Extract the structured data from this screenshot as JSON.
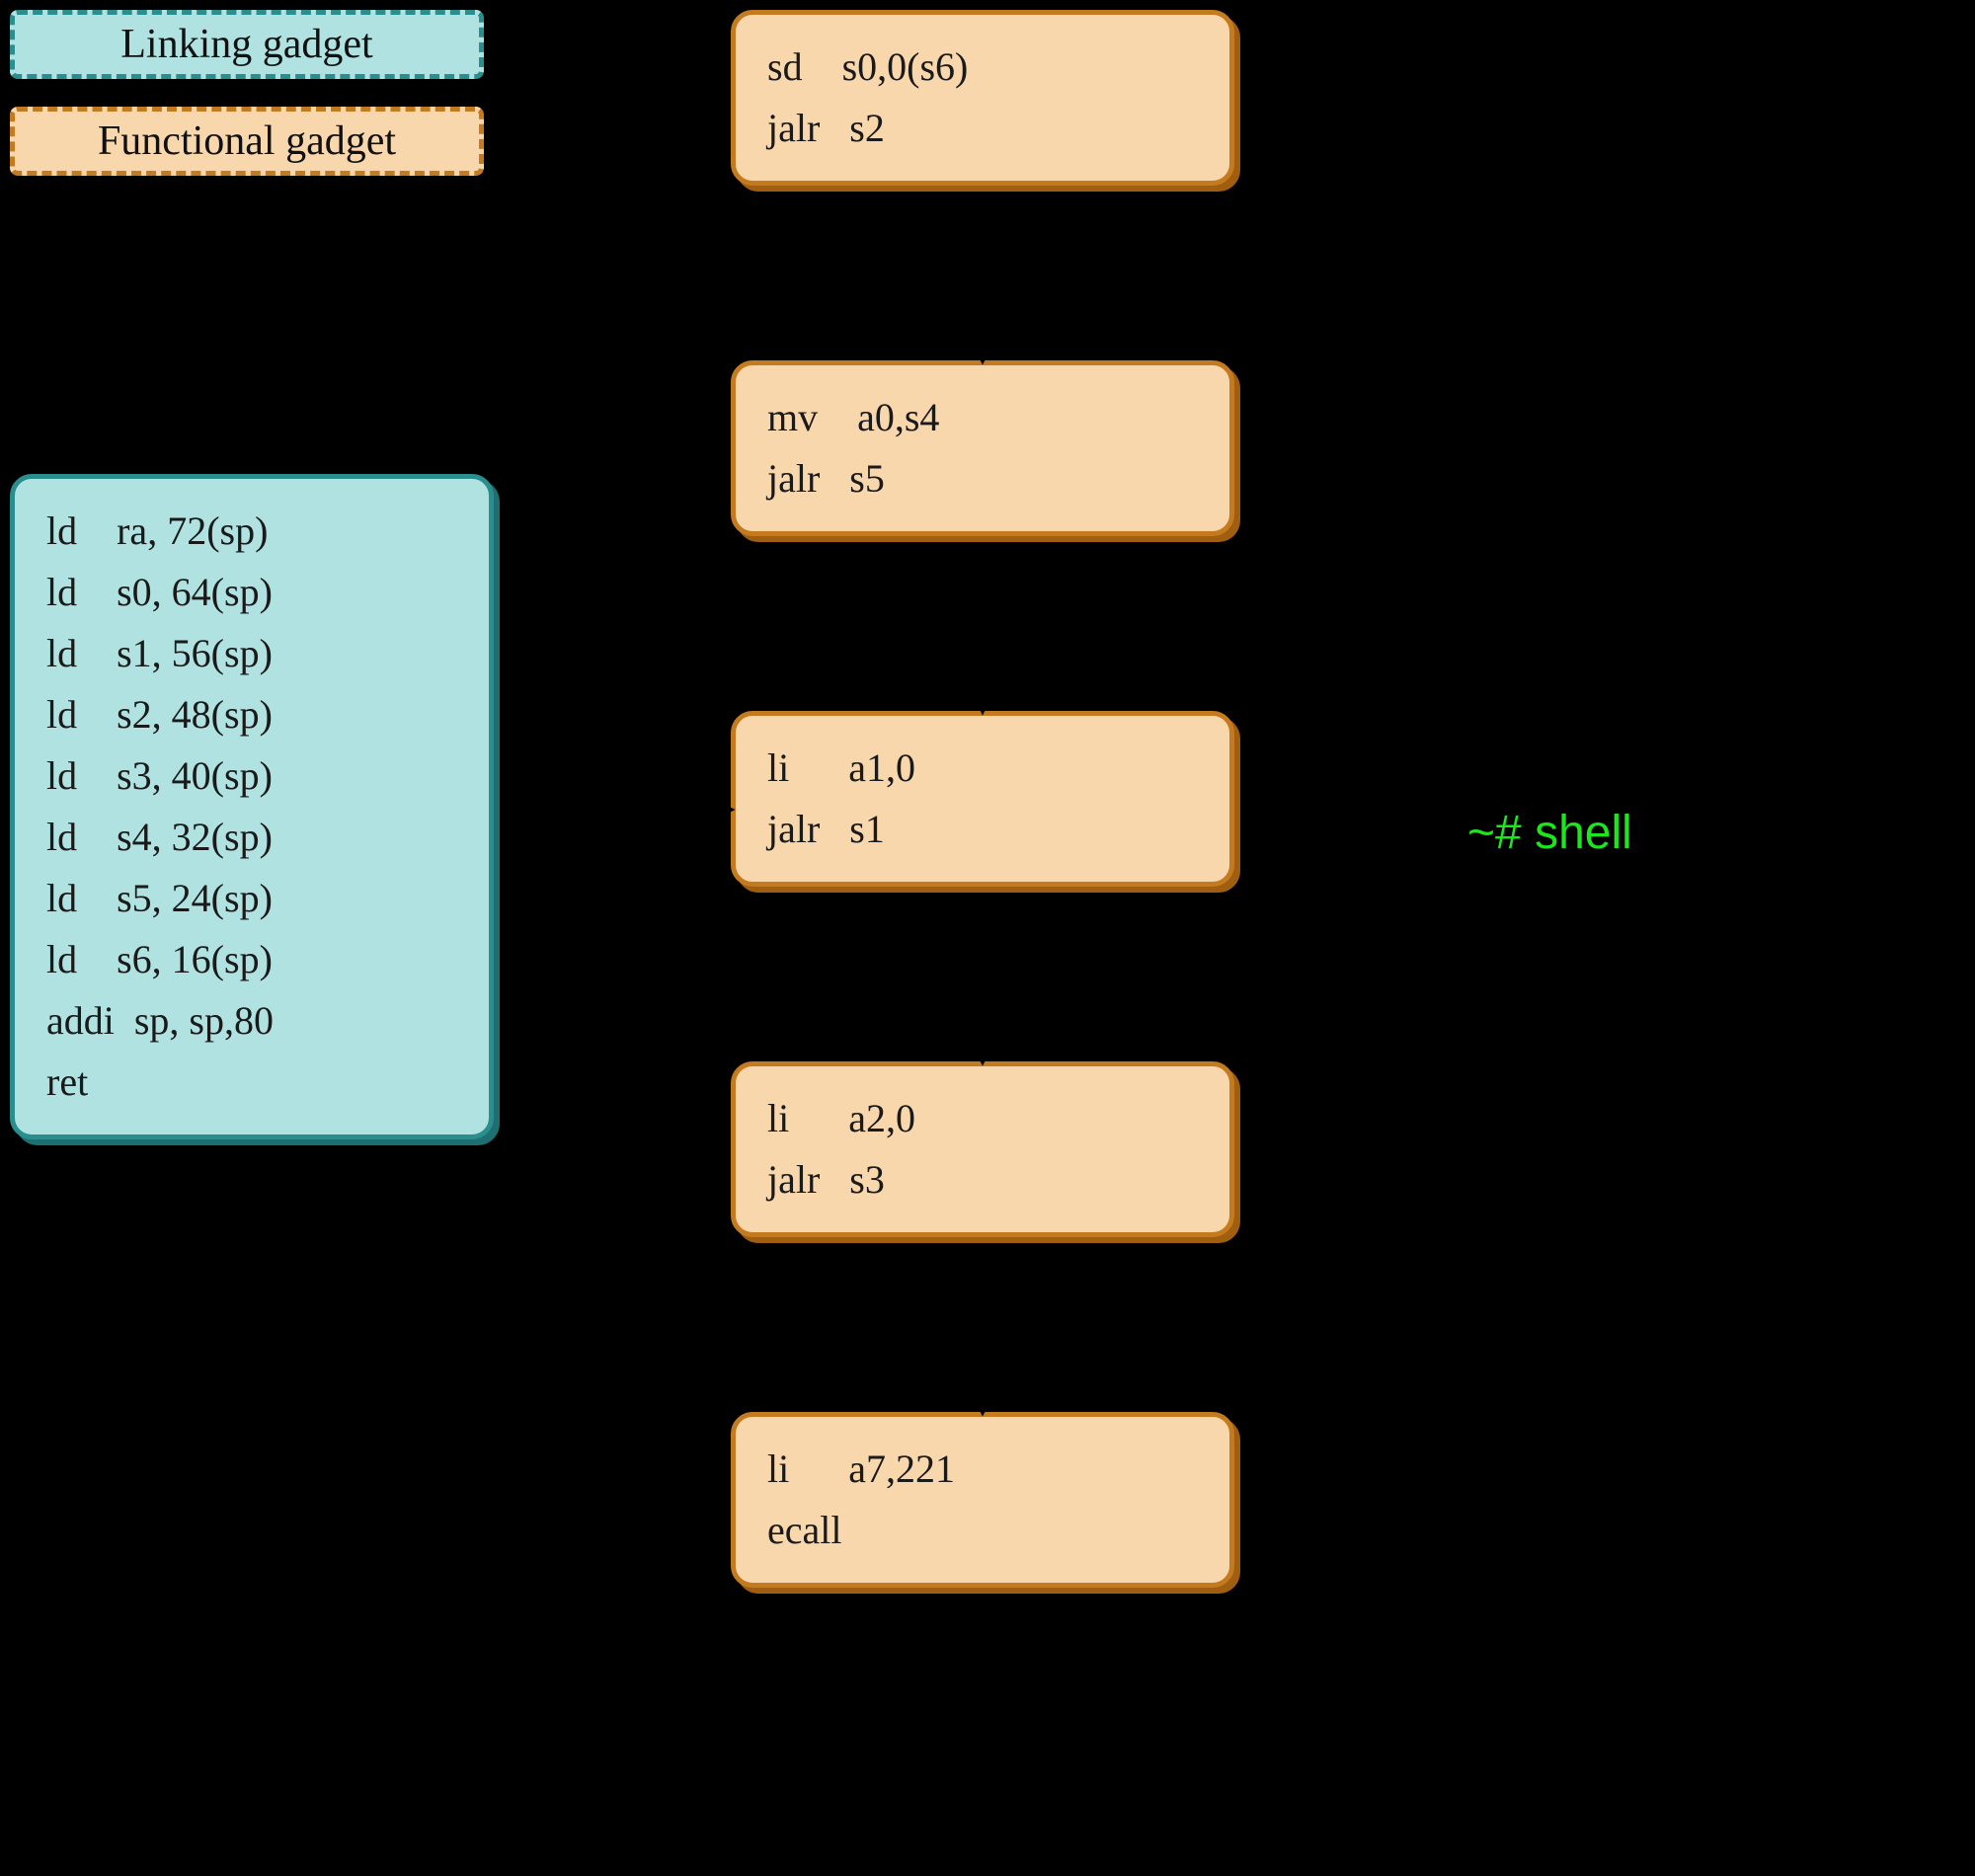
{
  "legend": {
    "linking_label": "Linking gadget",
    "functional_label": "Functional gadget"
  },
  "colors": {
    "linking_fill": "#afe2e0",
    "linking_border": "#2a8e8e",
    "functional_fill": "#f9d7ad",
    "functional_border": "#c47a1e",
    "shell_text": "#1ce61c",
    "background": "#000000"
  },
  "linking_gadget": {
    "code": "ld    ra, 72(sp)\nld    s0, 64(sp)\nld    s1, 56(sp)\nld    s2, 48(sp)\nld    s3, 40(sp)\nld    s4, 32(sp)\nld    s5, 24(sp)\nld    s6, 16(sp)\naddi  sp, sp,80\nret"
  },
  "functional_gadgets": [
    {
      "code": "sd    s0,0(s6)\njalr   s2"
    },
    {
      "code": "mv    a0,s4\njalr   s5"
    },
    {
      "code": "li      a1,0\njalr   s1"
    },
    {
      "code": "li      a2,0\njalr   s3"
    },
    {
      "code": "li      a7,221\necall"
    }
  ],
  "output": {
    "shell_text": "~# shell"
  }
}
